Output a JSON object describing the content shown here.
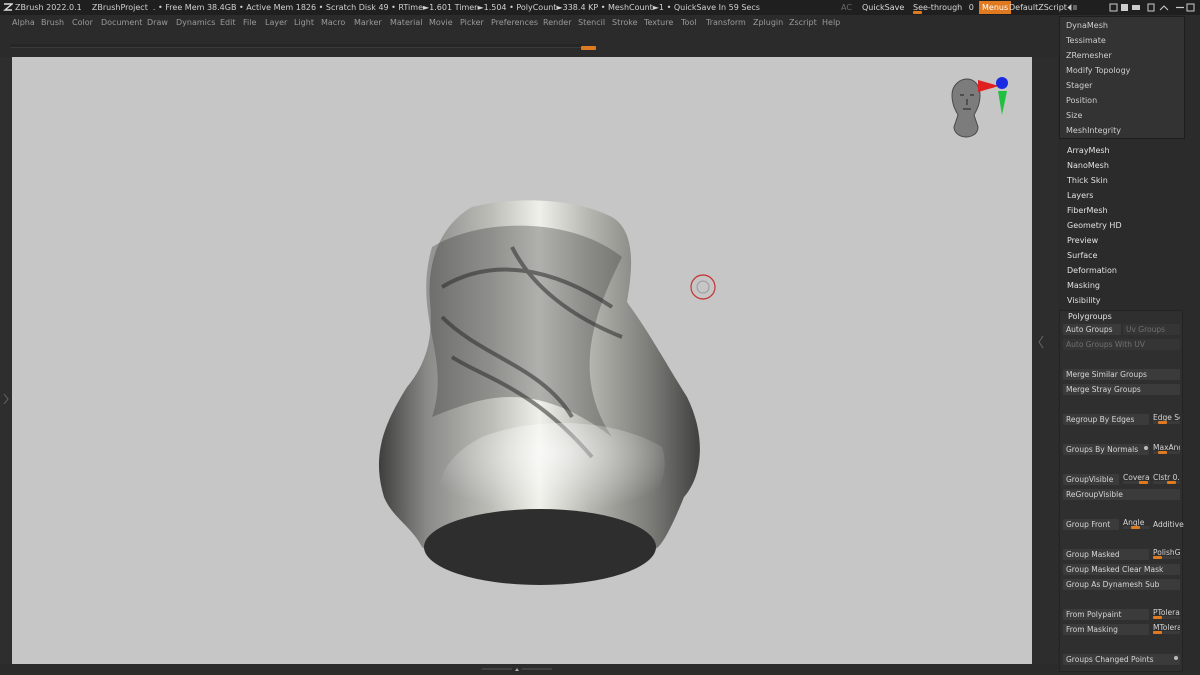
{
  "titlebar": {
    "app_title": "ZBrush 2022.0.1",
    "project": "ZBrushProject",
    "free_mem": "• Free Mem 38.4GB",
    "active_mem": "• Active Mem 1826",
    "scratch_disk": "• Scratch Disk 49",
    "rtime": "• RTime►1.601",
    "timer": "Timer►1.504",
    "polycount": "• PolyCount►338.4 KP",
    "meshcount": "• MeshCount►1",
    "quicksave_timer": "• QuickSave In 59 Secs",
    "ac_label": "AC",
    "quicksave_label": "QuickSave",
    "see_through_label": "See-through",
    "see_through_value": "0",
    "menus_label": "Menus",
    "script_label": "DefaultZScript"
  },
  "menubar": [
    "Alpha",
    "Brush",
    "Color",
    "Document",
    "Draw",
    "Dynamics",
    "Edit",
    "File",
    "Layer",
    "Light",
    "Macro",
    "Marker",
    "Material",
    "Movie",
    "Picker",
    "Preferences",
    "Render",
    "Stencil",
    "Stroke",
    "Texture",
    "Tool",
    "Transform",
    "Zplugin",
    "Zscript",
    "Help"
  ],
  "submenu": [
    "DynaMesh",
    "Tessimate",
    "ZRemesher",
    "Modify Topology",
    "Stager",
    "Position",
    "Size",
    "MeshIntegrity"
  ],
  "sections": [
    "ArrayMesh",
    "NanoMesh",
    "Thick Skin",
    "Layers",
    "FiberMesh",
    "Geometry HD",
    "Preview",
    "Surface",
    "Deformation",
    "Masking",
    "Visibility",
    "Polygroups"
  ],
  "polygroups": {
    "auto_groups": "Auto Groups",
    "uv_groups": "Uv Groups",
    "auto_groups_uv": "Auto Groups With UV",
    "merge_similar": "Merge Similar Groups",
    "merge_stray": "Merge Stray Groups",
    "regroup_edges": "Regroup By Edges",
    "edge_se": "Edge Se",
    "groups_normals": "Groups By Normals",
    "max_ang": "MaxAng",
    "group_visible": "GroupVisible",
    "coverage": "Coverag",
    "clstr": "Clstr 0.",
    "regroup_visible": "ReGroupVisible",
    "group_front": "Group Front",
    "angle": "Angle",
    "additive": "Additive",
    "group_masked": "Group Masked",
    "polish_g": "PolishG",
    "group_masked_clear": "Group Masked Clear Mask",
    "group_dynamesh": "Group As Dynamesh Sub",
    "from_polypaint": "From Polypaint",
    "ptolera": "PTolera",
    "from_masking": "From Masking",
    "mtolera": "MTolera",
    "changed_points": "Groups Changed Points"
  },
  "colors": {
    "accent": "#e07a20",
    "viewport_bg": "#c6c6c6",
    "panel_bg": "#2b2b2b"
  }
}
